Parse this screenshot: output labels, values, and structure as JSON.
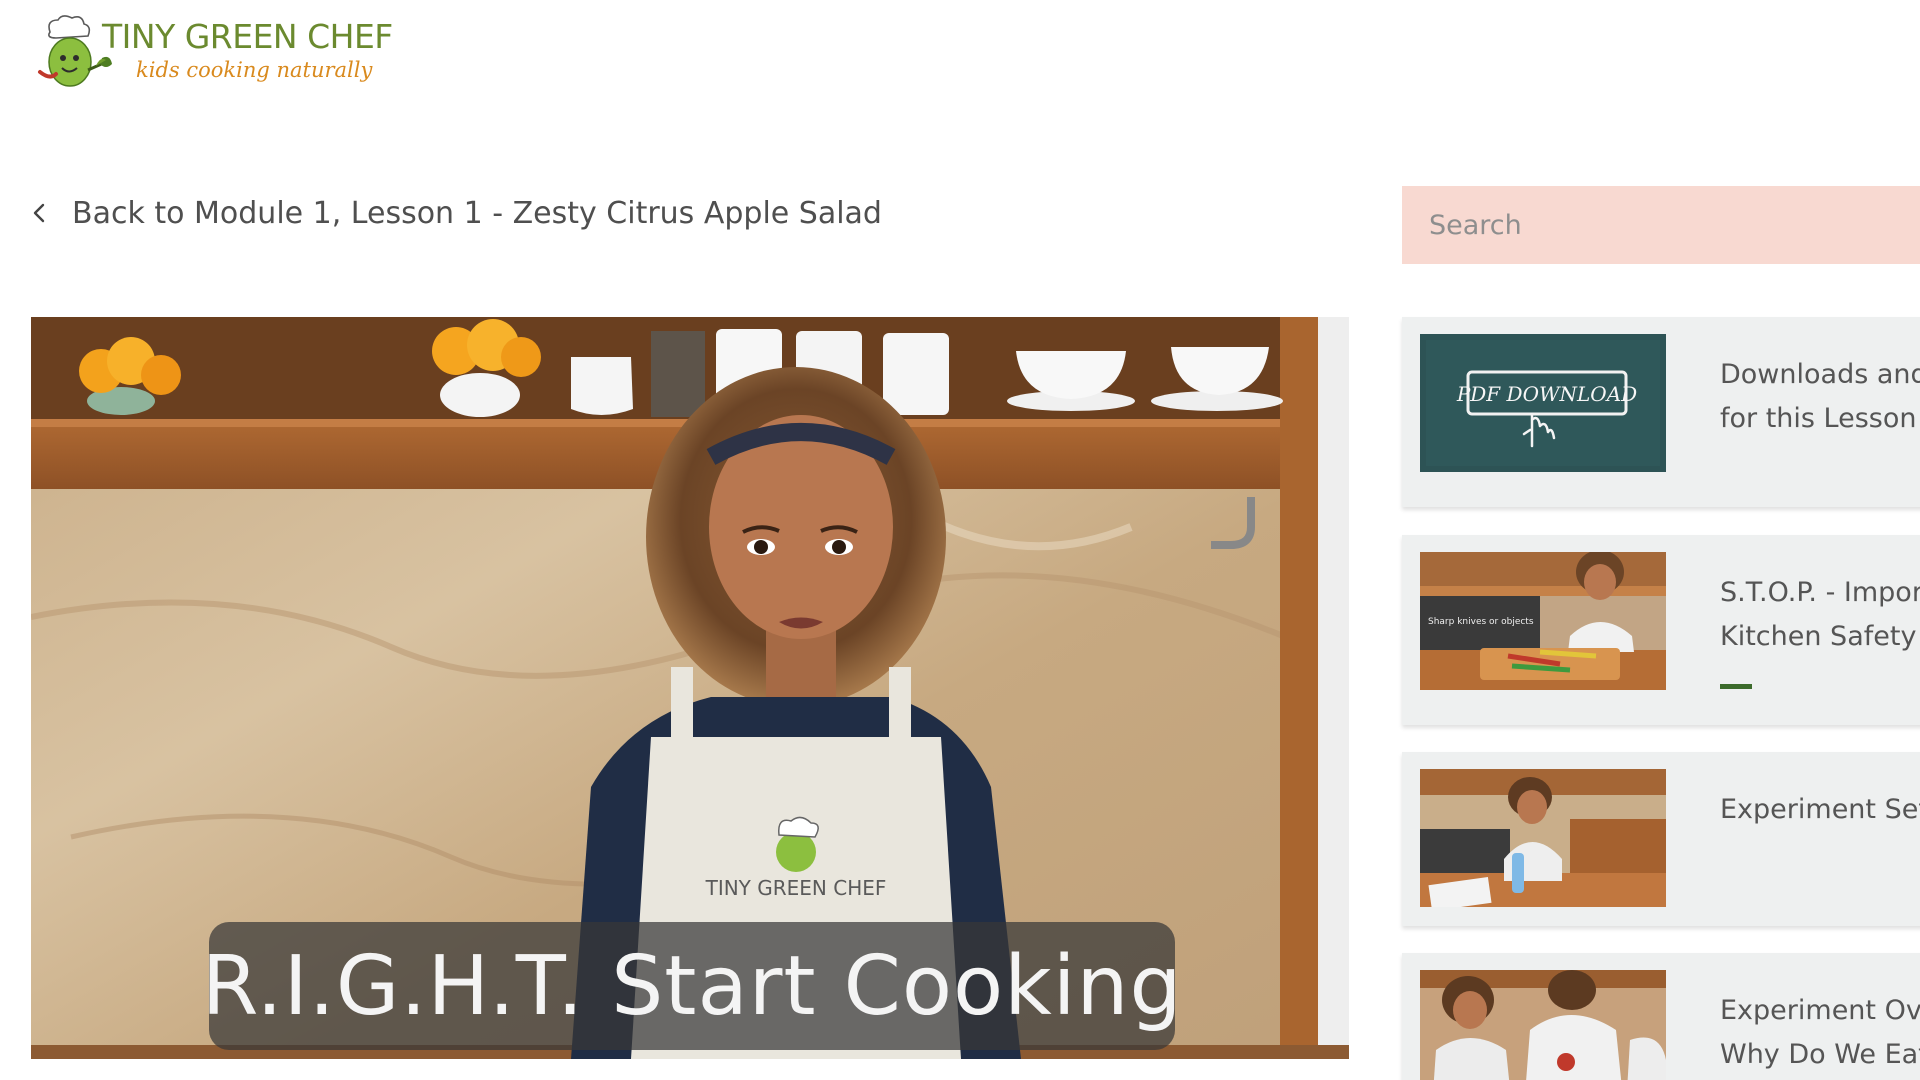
{
  "logo": {
    "name": "TINY GREEN CHEF",
    "tagline": "kids cooking naturally"
  },
  "back_link": {
    "label": "Back to Module 1, Lesson 1 - Zesty Citrus Apple Salad"
  },
  "video": {
    "caption": "R.I.G.H.T. Start Cooking",
    "apron_text": "TINY GREEN CHEF"
  },
  "search": {
    "placeholder": "Search"
  },
  "lessons": [
    {
      "title_line1": "Downloads and",
      "title_line2": "for this Lesson",
      "thumb_text": "PDF DOWNLOAD",
      "thumb": "pdf-download-chalkboard"
    },
    {
      "title_line1": "S.T.O.P. - Import",
      "title_line2": "Kitchen Safety",
      "thumb_text": "Sharp knives or objects",
      "thumb": "kitchen-safety-knives",
      "progress": 0.1
    },
    {
      "title_line1": "Experiment Set-",
      "title_line2": "",
      "thumb": "experiment-setup-kitchen"
    },
    {
      "title_line1": "Experiment Ove",
      "title_line2": "Why Do We Eat?",
      "thumb": "experiment-kids-eating"
    }
  ],
  "colors": {
    "brand_green": "#6b8a2f",
    "brand_orange": "#d98a1e",
    "search_bg": "#f8d9d1",
    "card_bg": "#eef0f0",
    "progress": "#3c6b2c"
  }
}
